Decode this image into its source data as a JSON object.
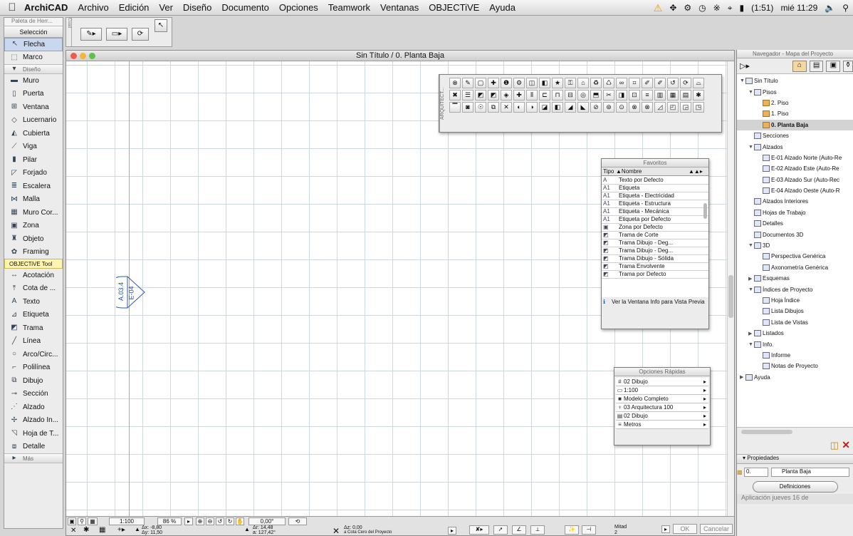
{
  "menubar": {
    "app": "ArchiCAD",
    "items": [
      "Archivo",
      "Edición",
      "Ver",
      "Diseño",
      "Documento",
      "Opciones",
      "Teamwork",
      "Ventanas",
      "OBJECTiVE",
      "Ayuda"
    ],
    "status": "(1:51)",
    "clock": "mié 11:29"
  },
  "toolbox": {
    "title": "Paleta de Herr...",
    "selection_label": "Selección",
    "tools_top": [
      {
        "label": "Flecha",
        "icon": "arrow-icon"
      },
      {
        "label": "Marco",
        "icon": "marquee-icon"
      }
    ],
    "design_label": "Diseño",
    "design_tools": [
      {
        "label": "Muro",
        "icon": "wall-icon"
      },
      {
        "label": "Puerta",
        "icon": "door-icon"
      },
      {
        "label": "Ventana",
        "icon": "window-icon"
      },
      {
        "label": "Lucernario",
        "icon": "skylight-icon"
      },
      {
        "label": "Cubierta",
        "icon": "roof-icon"
      },
      {
        "label": "Viga",
        "icon": "beam-icon"
      },
      {
        "label": "Pilar",
        "icon": "column-icon"
      },
      {
        "label": "Forjado",
        "icon": "slab-icon"
      },
      {
        "label": "Escalera",
        "icon": "stair-icon"
      },
      {
        "label": "Malla",
        "icon": "mesh-icon"
      },
      {
        "label": "Muro Cor...",
        "icon": "curtain-wall-icon"
      },
      {
        "label": "Zona",
        "icon": "zone-icon"
      },
      {
        "label": "Objeto",
        "icon": "object-icon"
      },
      {
        "label": "Framing",
        "icon": "framing-icon"
      }
    ],
    "objective_label": "OBJECTiVE Tool",
    "doc_tools": [
      {
        "label": "Acotación",
        "icon": "dimension-icon"
      },
      {
        "label": "Cota de ...",
        "icon": "level-dimension-icon"
      },
      {
        "label": "Texto",
        "icon": "text-icon"
      },
      {
        "label": "Etiqueta",
        "icon": "label-icon"
      },
      {
        "label": "Trama",
        "icon": "fill-icon"
      },
      {
        "label": "Línea",
        "icon": "line-icon"
      },
      {
        "label": "Arco/Circ...",
        "icon": "arc-icon"
      },
      {
        "label": "Polilínea",
        "icon": "polyline-icon"
      },
      {
        "label": "Dibujo",
        "icon": "drawing-icon"
      },
      {
        "label": "Sección",
        "icon": "section-icon"
      },
      {
        "label": "Alzado",
        "icon": "elevation-icon"
      },
      {
        "label": "Alzado In...",
        "icon": "interior-elevation-icon"
      },
      {
        "label": "Hoja de T...",
        "icon": "worksheet-icon"
      },
      {
        "label": "Detalle",
        "icon": "detail-icon"
      }
    ],
    "more_label": "Más"
  },
  "infobox": {
    "side_label": "Cuad"
  },
  "window": {
    "title": "Sin Título / 0. Planta Baja",
    "marker_top": "A.03.4",
    "marker_bottom": "E-04"
  },
  "statusbar": {
    "scale": "1:100",
    "zoom": "86 %",
    "angle": "0,00°",
    "dx": "-8,80",
    "dy": "11,50",
    "dr": "14,48",
    "da": "127,42°",
    "dz": "0,00",
    "z_ref": "a Cota Cero del Proyecto",
    "snap": "Mitad",
    "snap_n": "2",
    "ok": "OK",
    "cancel": "Cancelar"
  },
  "arq_palette": {
    "side_label": "ARQUITECT..."
  },
  "favoritos": {
    "title": "Favoritos",
    "col_tipo": "Tipo",
    "col_nombre": "Nombre",
    "rows": [
      {
        "tipo": "A",
        "nombre": "Texto por Defecto"
      },
      {
        "tipo": "A1",
        "nombre": "Etiqueta"
      },
      {
        "tipo": "A1",
        "nombre": "Etiqueta - Electricidad"
      },
      {
        "tipo": "A1",
        "nombre": "Etiqueta - Estructura"
      },
      {
        "tipo": "A1",
        "nombre": "Etiqueta - Mecánica"
      },
      {
        "tipo": "A1",
        "nombre": "Etiqueta por Defecto"
      },
      {
        "tipo": "▣",
        "nombre": "Zona por Defecto"
      },
      {
        "tipo": "◩",
        "nombre": "Trama de Corte"
      },
      {
        "tipo": "◩",
        "nombre": "Trama Dibujo - Deg..."
      },
      {
        "tipo": "◩",
        "nombre": "Trama Dibujo - Deg..."
      },
      {
        "tipo": "◩",
        "nombre": "Trama Dibujo - Sólida"
      },
      {
        "tipo": "◩",
        "nombre": "Trama Envolvente"
      },
      {
        "tipo": "◩",
        "nombre": "Trama por Defecto"
      }
    ],
    "preview_note": "Ver la Ventana Info para Vista Previa"
  },
  "quick": {
    "title": "Opciones Rápidas",
    "rows": [
      {
        "icon": "#",
        "label": "02 Dibujo"
      },
      {
        "icon": "▭",
        "label": "1:100"
      },
      {
        "icon": "■",
        "label": "Modelo Completo"
      },
      {
        "icon": "♆",
        "label": "03 Arquitectura 100"
      },
      {
        "icon": "▤",
        "label": "02 Dibujo"
      },
      {
        "icon": "≡",
        "label": "Metros"
      }
    ]
  },
  "navigator": {
    "title": "Navegador - Mapa del Proyecto",
    "tree": [
      {
        "label": "Sin Título",
        "level": 0,
        "open": true
      },
      {
        "label": "Pisos",
        "level": 1,
        "open": true
      },
      {
        "label": "2. Piso",
        "level": 2
      },
      {
        "label": "1. Piso",
        "level": 2
      },
      {
        "label": "0. Planta Baja",
        "level": 2,
        "selected": true
      },
      {
        "label": "Secciones",
        "level": 1
      },
      {
        "label": "Alzados",
        "level": 1,
        "open": true
      },
      {
        "label": "E-01 Alzado Norte (Auto-Re",
        "level": 2
      },
      {
        "label": "E-02 Alzado Este (Auto-Re",
        "level": 2
      },
      {
        "label": "E-03 Alzado Sur (Auto-Rec",
        "level": 2
      },
      {
        "label": "E-04 Alzado Oeste (Auto-R",
        "level": 2
      },
      {
        "label": "Alzados Interiores",
        "level": 1
      },
      {
        "label": "Hojas de Trabajo",
        "level": 1
      },
      {
        "label": "Detalles",
        "level": 1
      },
      {
        "label": "Documentos 3D",
        "level": 1
      },
      {
        "label": "3D",
        "level": 1,
        "open": true
      },
      {
        "label": "Perspectiva Genérica",
        "level": 2
      },
      {
        "label": "Axonometría Genérica",
        "level": 2
      },
      {
        "label": "Esquemas",
        "level": 1,
        "closed": true
      },
      {
        "label": "Índices de Proyecto",
        "level": 1,
        "open": true
      },
      {
        "label": "Hoja Índice",
        "level": 2
      },
      {
        "label": "Lista Dibujos",
        "level": 2
      },
      {
        "label": "Lista de Vistas",
        "level": 2
      },
      {
        "label": "Listados",
        "level": 1,
        "closed": true
      },
      {
        "label": "Info.",
        "level": 1,
        "open": true
      },
      {
        "label": "Informe",
        "level": 2
      },
      {
        "label": "Notas de Proyecto",
        "level": 2
      },
      {
        "label": "Ayuda",
        "level": 0,
        "closed": true
      }
    ],
    "props_label": "Propiedades",
    "prop_id": "0.",
    "prop_name": "Planta Baja",
    "definitions": "Definiciones",
    "footer": "Aplicación   jueves 16 de"
  },
  "colors": {
    "grid": "#cfd8dd",
    "marker": "#1f4fa3",
    "accent": "#c9d8ee"
  }
}
